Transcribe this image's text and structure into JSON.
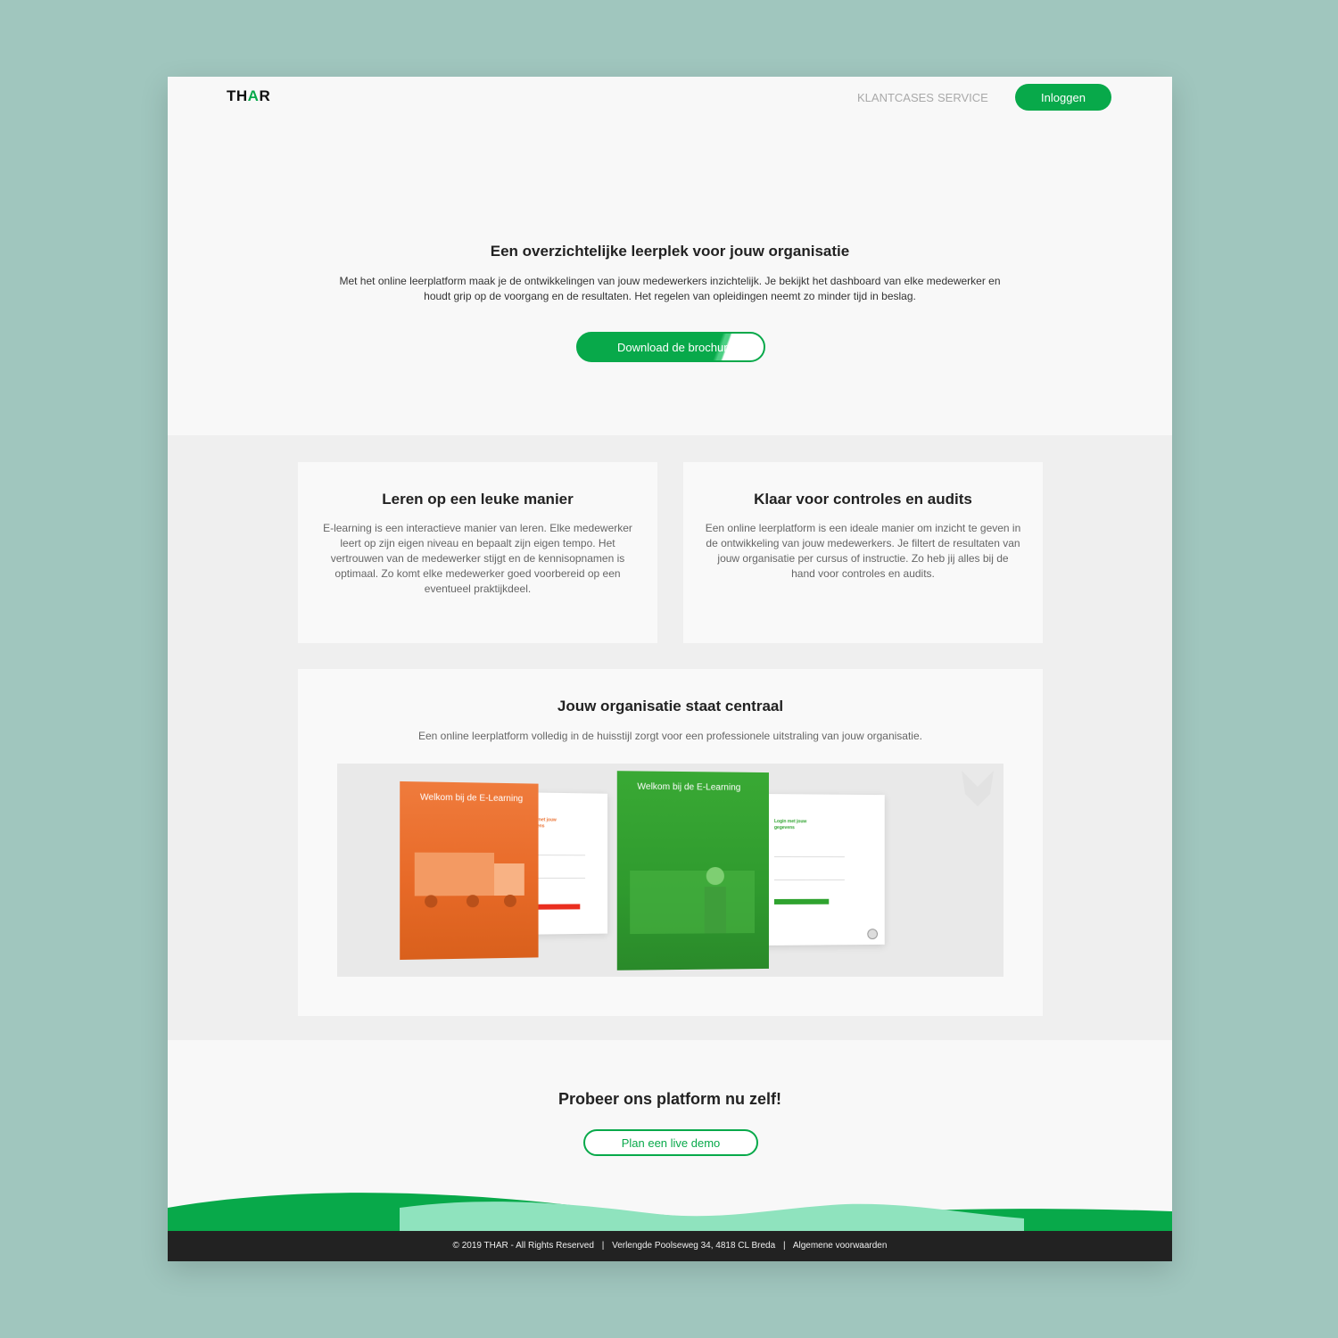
{
  "header": {
    "logo_prefix": "TH",
    "logo_accent": "A",
    "logo_suffix": "R",
    "nav": [
      "KLANTCASES",
      "SERVICE"
    ],
    "login_label": "Inloggen"
  },
  "hero": {
    "title": "Een overzichtelijke leerplek voor jouw organisatie",
    "text": "Met het online leerplatform maak je de ontwikkelingen van jouw medewerkers inzichtelijk. Je bekijkt het dashboard van elke medewerker en houdt grip op de voorgang en de resultaten. Het regelen van opleidingen neemt zo minder tijd in beslag.",
    "button_label": "Download de brochure"
  },
  "cards": [
    {
      "title": "Leren op een leuke manier",
      "text": "E-learning is een interactieve manier van leren. Elke medewerker leert op zijn eigen niveau en bepaalt zijn eigen tempo. Het vertrouwen van de medewerker stijgt en de kennisopnamen is optimaal. Zo komt elke medewerker goed voorbereid op een eventueel praktijkdeel."
    },
    {
      "title": "Klaar voor controles en audits",
      "text": "Een online leerplatform is een ideale manier om inzicht te geven in de ontwikkeling van jouw medewerkers. Je filtert de resultaten van jouw organisatie per cursus of instructie. Zo heb jij alles bij de hand voor controles en audits."
    }
  ],
  "central": {
    "title": "Jouw organisatie staat centraal",
    "text": "Een online leerplatform volledig in de huisstijl zorgt voor een professionele uitstraling van jouw organisatie.",
    "mockups": [
      {
        "panel_title": "Welkom bij de E-Learning",
        "form_title": "Login met jouw gegevens",
        "color": "#ea7131"
      },
      {
        "panel_title": "Welkom bij de E-Learning",
        "form_title": "Login met jouw gegevens",
        "color": "#2fa32f"
      }
    ]
  },
  "cta": {
    "title": "Probeer ons platform nu zelf!",
    "button_label": "Plan een live demo"
  },
  "footer": {
    "copyright": "© 2019 THAR - All Rights Reserved",
    "address": "Verlengde Poolseweg 34, 4818 CL Breda",
    "terms": "Algemene voorwaarden"
  },
  "colors": {
    "brand_green": "#08a94a",
    "light_green": "#8fe3be",
    "footer_bg": "#222222",
    "background": "#a0c6be"
  }
}
